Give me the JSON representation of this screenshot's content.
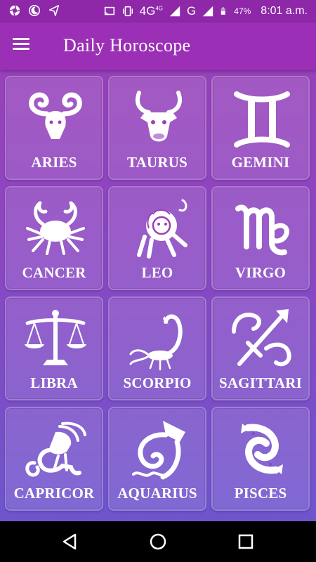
{
  "status_bar": {
    "network": "4G",
    "network_sup": "4G",
    "carrier": "G",
    "battery": "47%",
    "time": "8:01 a.m.",
    "left_icons": [
      "aperture-icon",
      "moon-icon",
      "navigation-icon"
    ],
    "right_icons": [
      "cast-icon",
      "vibrate-icon",
      "signal-icon",
      "signal-icon",
      "battery-icon"
    ]
  },
  "app_bar": {
    "title": "Daily Horoscope",
    "menu_icon": "hamburger-menu-icon"
  },
  "signs": [
    {
      "label": "ARIES",
      "icon": "aries-icon"
    },
    {
      "label": "TAURUS",
      "icon": "taurus-icon"
    },
    {
      "label": "GEMINI",
      "icon": "gemini-icon"
    },
    {
      "label": "CANCER",
      "icon": "cancer-icon"
    },
    {
      "label": "LEO",
      "icon": "leo-icon"
    },
    {
      "label": "VIRGO",
      "icon": "virgo-icon"
    },
    {
      "label": "LIBRA",
      "icon": "libra-icon"
    },
    {
      "label": "SCORPIO",
      "icon": "scorpio-icon"
    },
    {
      "label": "SAGITTARI",
      "icon": "sagittarius-icon"
    },
    {
      "label": "CAPRICOR",
      "icon": "capricorn-icon"
    },
    {
      "label": "AQUARIUS",
      "icon": "aquarius-icon"
    },
    {
      "label": "PISCES",
      "icon": "pisces-icon"
    }
  ],
  "nav_bar": {
    "icons": [
      "back-icon",
      "home-icon",
      "recents-icon"
    ]
  },
  "colors": {
    "app_bar": "#9b2fb5",
    "status_bar": "#8e27a8",
    "background_top": "#9c3fb7",
    "background_bottom": "#6a57cf"
  }
}
